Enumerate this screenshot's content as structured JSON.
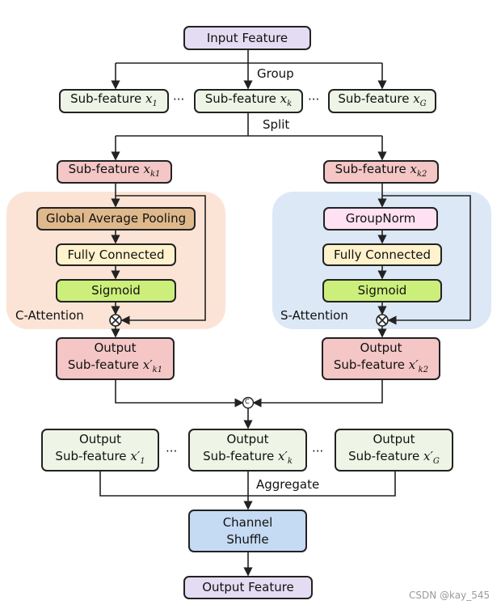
{
  "input": "Input Feature",
  "group_label": "Group",
  "split_label": "Split",
  "aggregate_label": "Aggregate",
  "ellipsis": "···",
  "sub_prefix": "Sub-feature ",
  "output_word": "Output",
  "var": "x",
  "var_prime": "x′",
  "subs": {
    "s1": "1",
    "sk": "k",
    "sG": "G",
    "k1": "k1",
    "k2": "k2"
  },
  "c_attention": {
    "label": "C-Attention",
    "gap": "Global Average Pooling",
    "fc": "Fully Connected",
    "sig": "Sigmoid"
  },
  "s_attention": {
    "label": "S-Attention",
    "gn": "GroupNorm",
    "fc": "Fully Connected",
    "sig": "Sigmoid"
  },
  "concat_symbol": "C",
  "shuffle": {
    "line1": "Channel",
    "line2": "Shuffle"
  },
  "output": "Output Feature",
  "watermark": "CSDN @kay_545",
  "colors": {
    "input": "#e4dcf2",
    "subfeature": "#eef5e6",
    "branch": "#f4c6c6",
    "c_panel": "#fbe4d6",
    "s_panel": "#dce8f5",
    "gap": "#dfb98c",
    "fc": "#fff2cc",
    "sigmoid": "#ccef7c",
    "groupnorm": "#ffe1f2",
    "shuffle": "#c5daf3"
  }
}
